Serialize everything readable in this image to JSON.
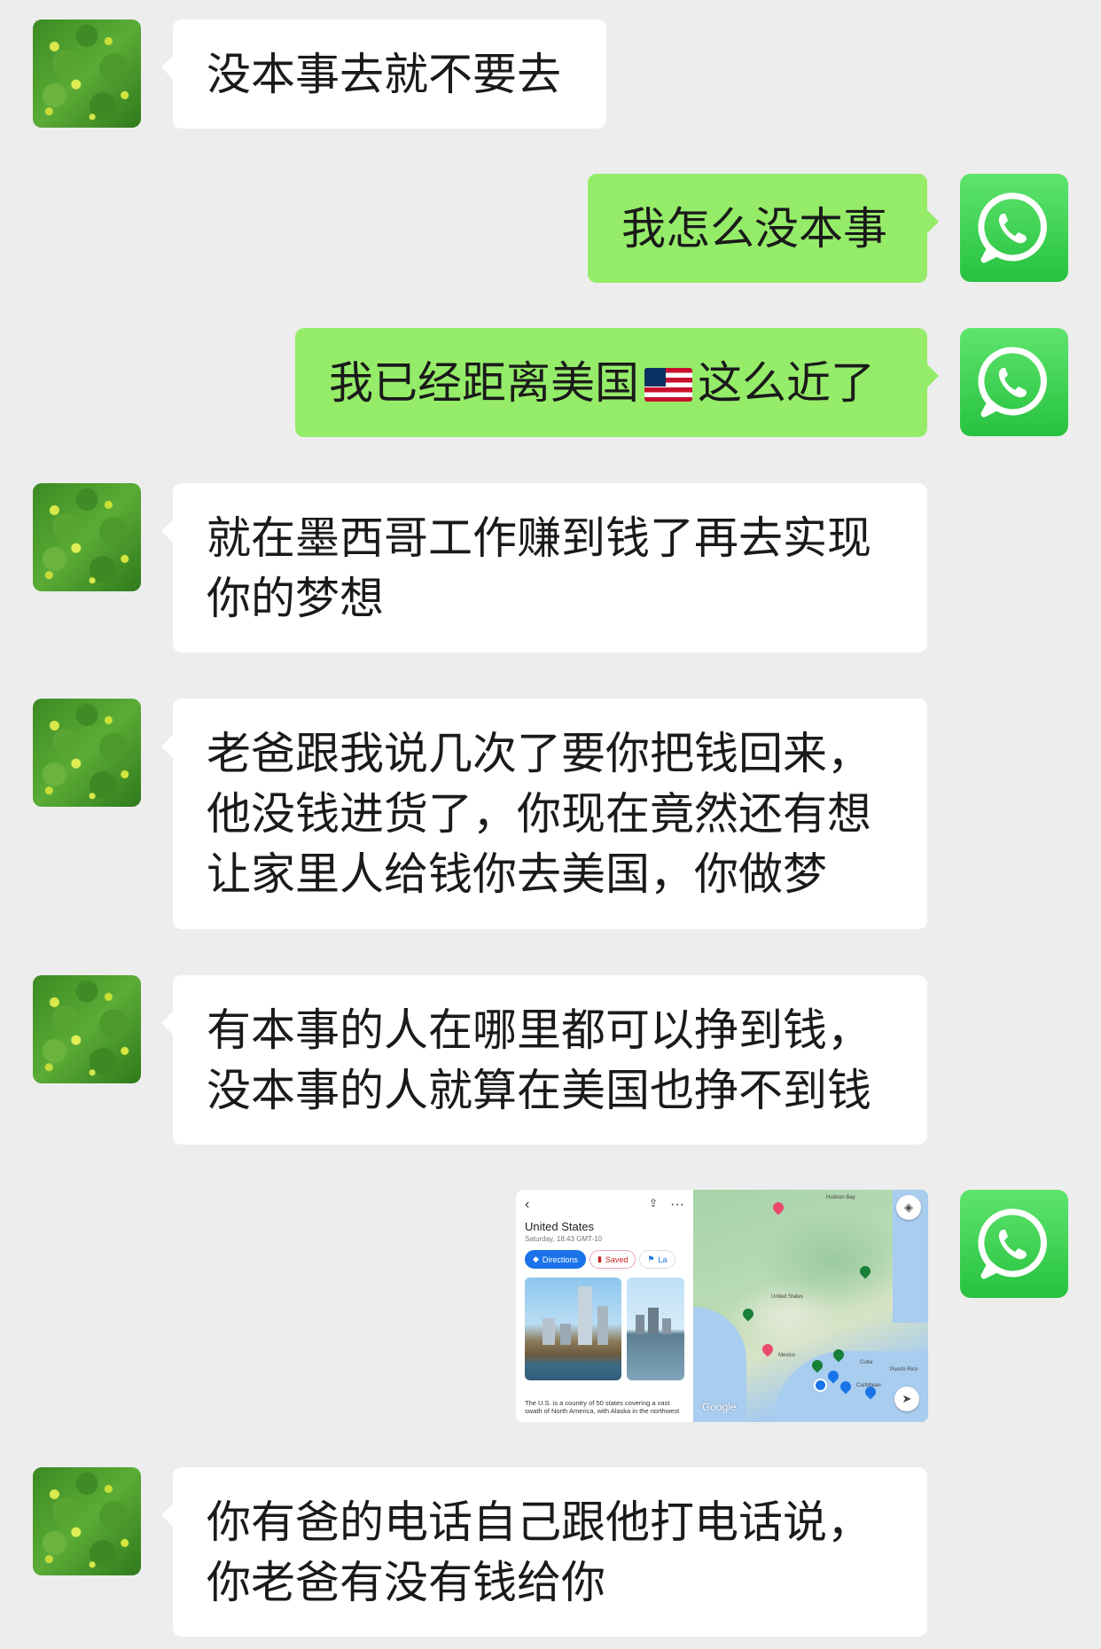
{
  "messages": [
    {
      "from": "contact",
      "text": "没本事去就不要去"
    },
    {
      "from": "me",
      "text": "我怎么没本事"
    },
    {
      "from": "me",
      "text_before_flag": "我已经距离美国",
      "flag_icon": "us-flag-icon",
      "text_after_flag": "这么近了"
    },
    {
      "from": "contact",
      "text": "就在墨西哥工作赚到钱了再去实现你的梦想"
    },
    {
      "from": "contact",
      "text": "老爸跟我说几次了要你把钱回来，他没钱进货了，你现在竟然还有想让家里人给钱你去美国，你做梦"
    },
    {
      "from": "contact",
      "text": "有本事的人在哪里都可以挣到钱，没本事的人就算在美国也挣不到钱"
    },
    {
      "from": "me",
      "type": "image",
      "map_card": {
        "title": "United States",
        "subtitle": "Saturday, 18:43 GMT-10",
        "chips": [
          "Directions",
          "Saved",
          "La"
        ],
        "description": "The U.S. is a country of 50 states covering a vast swath of North America, with Alaska in the northwest",
        "map_labels": [
          "Hudson Bay",
          "United States",
          "Mexico",
          "Cuba",
          "Puerto Rico",
          "Caribbean"
        ],
        "google_logo": "Google"
      }
    },
    {
      "from": "contact",
      "text": "你有爸的电话自己跟他打电话说，你老爸有没有钱给你"
    }
  ],
  "colors": {
    "background": "#ededed",
    "received_bubble": "#ffffff",
    "sent_bubble": "#95ec69",
    "whatsapp_green": "#25d366"
  },
  "icons": {
    "contact_avatar": "green-leaves-avatar",
    "my_avatar": "whatsapp-icon"
  }
}
